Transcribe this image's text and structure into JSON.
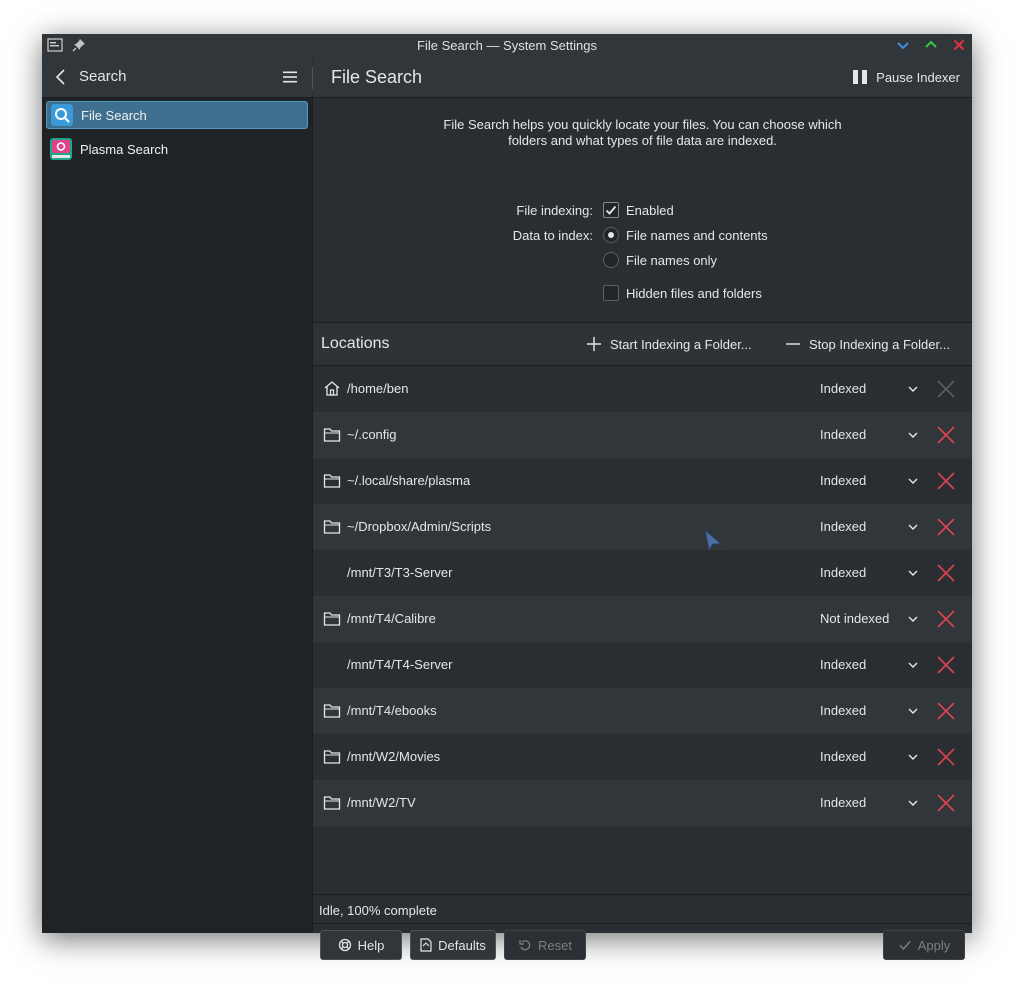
{
  "window": {
    "title": "File Search — System Settings"
  },
  "header": {
    "back_label": "Search",
    "page_title": "File Search",
    "pause_label": "Pause Indexer"
  },
  "sidebar": {
    "items": [
      {
        "label": "File Search",
        "icon": "file-search-icon",
        "active": true
      },
      {
        "label": "Plasma Search",
        "icon": "plasma-search-icon",
        "active": false
      }
    ]
  },
  "main": {
    "description_line1": "File Search helps you quickly locate your files. You can choose which",
    "description_line2": "folders and what types of file data are indexed.",
    "file_indexing_label": "File indexing:",
    "enabled_label": "Enabled",
    "enabled_checked": true,
    "data_to_index_label": "Data to index:",
    "option_names_contents": "File names and contents",
    "option_names_only": "File names only",
    "selected_option": "File names and contents",
    "hidden_files_label": "Hidden files and folders",
    "hidden_files_checked": false
  },
  "locations": {
    "title": "Locations",
    "start_label": "Start Indexing a Folder...",
    "stop_label": "Stop Indexing a Folder...",
    "rows": [
      {
        "path": "/home/ben",
        "status": "Indexed",
        "icon": "home-icon",
        "removable": false
      },
      {
        "path": "~/.config",
        "status": "Indexed",
        "icon": "folder-icon",
        "removable": true
      },
      {
        "path": "~/.local/share/plasma",
        "status": "Indexed",
        "icon": "folder-icon",
        "removable": true
      },
      {
        "path": "~/Dropbox/Admin/Scripts",
        "status": "Indexed",
        "icon": "folder-icon",
        "removable": true
      },
      {
        "path": "/mnt/T3/T3-Server",
        "status": "Indexed",
        "icon": "none",
        "removable": true
      },
      {
        "path": "/mnt/T4/Calibre",
        "status": "Not indexed",
        "icon": "folder-icon",
        "removable": true
      },
      {
        "path": "/mnt/T4/T4-Server",
        "status": "Indexed",
        "icon": "none",
        "removable": true
      },
      {
        "path": "/mnt/T4/ebooks",
        "status": "Indexed",
        "icon": "folder-icon",
        "removable": true
      },
      {
        "path": "/mnt/W2/Movies",
        "status": "Indexed",
        "icon": "folder-icon",
        "removable": true
      },
      {
        "path": "/mnt/W2/TV",
        "status": "Indexed",
        "icon": "folder-icon",
        "removable": true
      }
    ]
  },
  "status": {
    "text": "Idle, 100% complete"
  },
  "footer": {
    "help_label": "Help",
    "defaults_label": "Defaults",
    "reset_label": "Reset",
    "apply_label": "Apply"
  },
  "colors": {
    "accent": "#3f6f8f",
    "remove_red": "#da4453",
    "window_bg": "#2a2e32",
    "sidebar_bg": "#202326"
  }
}
